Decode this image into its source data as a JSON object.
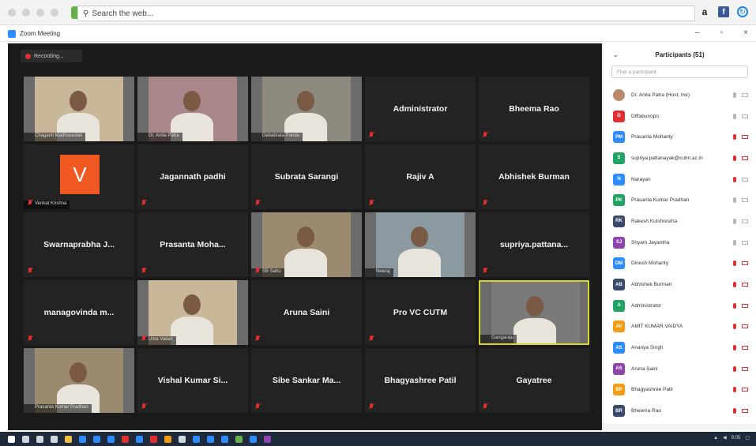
{
  "browser": {
    "search_placeholder": "Search the web..."
  },
  "window": {
    "title": "Zoom Meeting"
  },
  "recording": {
    "label": "Recording..."
  },
  "colors": {
    "meeting_bg": "#1a1a1a",
    "tile_bg": "#232323",
    "active_speaker": "#d6d62b",
    "muted": "#e03030",
    "accent": "#2d8cff"
  },
  "tiles": [
    {
      "name": "",
      "label": "Chaganti Madhusudan",
      "video": true,
      "muted": false
    },
    {
      "name": "",
      "label": "Dr. Anita Patra",
      "video": true,
      "muted": false
    },
    {
      "name": "",
      "label": "Debabrata Panda",
      "video": true,
      "muted": false
    },
    {
      "name": "Administrator",
      "label": "",
      "video": false,
      "muted": true
    },
    {
      "name": "Bheema Rao",
      "label": "",
      "video": false,
      "muted": true
    },
    {
      "name": "",
      "label": "Venkat Krishna",
      "video": false,
      "muted": true,
      "letter": "V"
    },
    {
      "name": "Jagannath padhi",
      "label": "",
      "video": false,
      "muted": true
    },
    {
      "name": "Subrata Sarangi",
      "label": "",
      "video": false,
      "muted": true
    },
    {
      "name": "Rajiv A",
      "label": "",
      "video": false,
      "muted": true
    },
    {
      "name": "Abhishek Burman",
      "label": "",
      "video": false,
      "muted": true
    },
    {
      "name": "Swarnaprabha J...",
      "label": "",
      "video": false,
      "muted": true
    },
    {
      "name": "Prasanta Moha...",
      "label": "",
      "video": false,
      "muted": true
    },
    {
      "name": "",
      "label": "SB Sahu",
      "video": true,
      "muted": true
    },
    {
      "name": "",
      "label": "Neeraj",
      "video": true,
      "muted": false
    },
    {
      "name": "supriya.pattana...",
      "label": "",
      "video": false,
      "muted": true
    },
    {
      "name": "managovinda m...",
      "label": "",
      "video": false,
      "muted": true
    },
    {
      "name": "",
      "label": "Uma Vallan",
      "video": true,
      "muted": true
    },
    {
      "name": "Aruna Saini",
      "label": "",
      "video": false,
      "muted": true
    },
    {
      "name": "Pro VC CUTM",
      "label": "",
      "video": false,
      "muted": true
    },
    {
      "name": "",
      "label": "Gangaraju",
      "video": true,
      "muted": false,
      "active": true
    },
    {
      "name": "",
      "label": "Prasanta Kumar Pradhan",
      "video": true,
      "muted": false
    },
    {
      "name": "Vishal Kumar Si...",
      "label": "",
      "video": false,
      "muted": true
    },
    {
      "name": "Sibe Sankar Ma...",
      "label": "",
      "video": false,
      "muted": true
    },
    {
      "name": "Bhagyashree Patil",
      "label": "",
      "video": false,
      "muted": true
    },
    {
      "name": "Gayatree",
      "label": "",
      "video": false,
      "muted": true
    }
  ],
  "participants": {
    "title": "Participants (51)",
    "search_placeholder": "Find a participant",
    "items": [
      {
        "initials": "",
        "name": "Dr. Anita Patra (Host, me)",
        "color": "#b98a6c",
        "photo": true,
        "mic_muted": false,
        "cam_off": false
      },
      {
        "initials": "D",
        "name": "Dlffabunopo",
        "color": "#e03030",
        "photo": false,
        "mic_muted": false,
        "cam_off": false
      },
      {
        "initials": "PM",
        "name": "Prasanta Mohanty",
        "color": "#2d8cff",
        "photo": false,
        "mic_muted": true,
        "cam_off": true
      },
      {
        "initials": "S",
        "name": "supriya.pattanayak@cutm.ac.in",
        "color": "#1fa463",
        "photo": false,
        "mic_muted": true,
        "cam_off": true
      },
      {
        "initials": "N",
        "name": "Narayan",
        "color": "#2d8cff",
        "photo": false,
        "mic_muted": true,
        "cam_off": false
      },
      {
        "initials": "PK",
        "name": "Prasanta Kumar Pradhan",
        "color": "#1fa463",
        "photo": false,
        "mic_muted": false,
        "cam_off": false
      },
      {
        "initials": "RK",
        "name": "Rakesh Kulshrestha",
        "color": "#3a4a6a",
        "photo": false,
        "mic_muted": false,
        "cam_off": false
      },
      {
        "initials": "SJ",
        "name": "Shyam Jayantha",
        "color": "#8e44ad",
        "photo": false,
        "mic_muted": false,
        "cam_off": false
      },
      {
        "initials": "DM",
        "name": "Dinesh Mohanty",
        "color": "#2d8cff",
        "photo": false,
        "mic_muted": true,
        "cam_off": true
      },
      {
        "initials": "AB",
        "name": "Abhishek Burman",
        "color": "#3a4a6a",
        "photo": false,
        "mic_muted": true,
        "cam_off": true
      },
      {
        "initials": "A",
        "name": "Administrator",
        "color": "#1fa463",
        "photo": false,
        "mic_muted": true,
        "cam_off": true
      },
      {
        "initials": "AV",
        "name": "AMIT KUMAR VAIDYA",
        "color": "#f39c12",
        "photo": false,
        "mic_muted": true,
        "cam_off": true
      },
      {
        "initials": "AS",
        "name": "Ananya Singh",
        "color": "#2d8cff",
        "photo": false,
        "mic_muted": true,
        "cam_off": true
      },
      {
        "initials": "AS",
        "name": "Aruna Saini",
        "color": "#8e44ad",
        "photo": false,
        "mic_muted": true,
        "cam_off": true
      },
      {
        "initials": "BP",
        "name": "Bhagyashree Patil",
        "color": "#f39c12",
        "photo": false,
        "mic_muted": true,
        "cam_off": true
      },
      {
        "initials": "BR",
        "name": "Bheema Rao",
        "color": "#3a4a6a",
        "photo": false,
        "mic_muted": true,
        "cam_off": true
      }
    ]
  },
  "taskbar": {
    "clock": "9:05"
  }
}
